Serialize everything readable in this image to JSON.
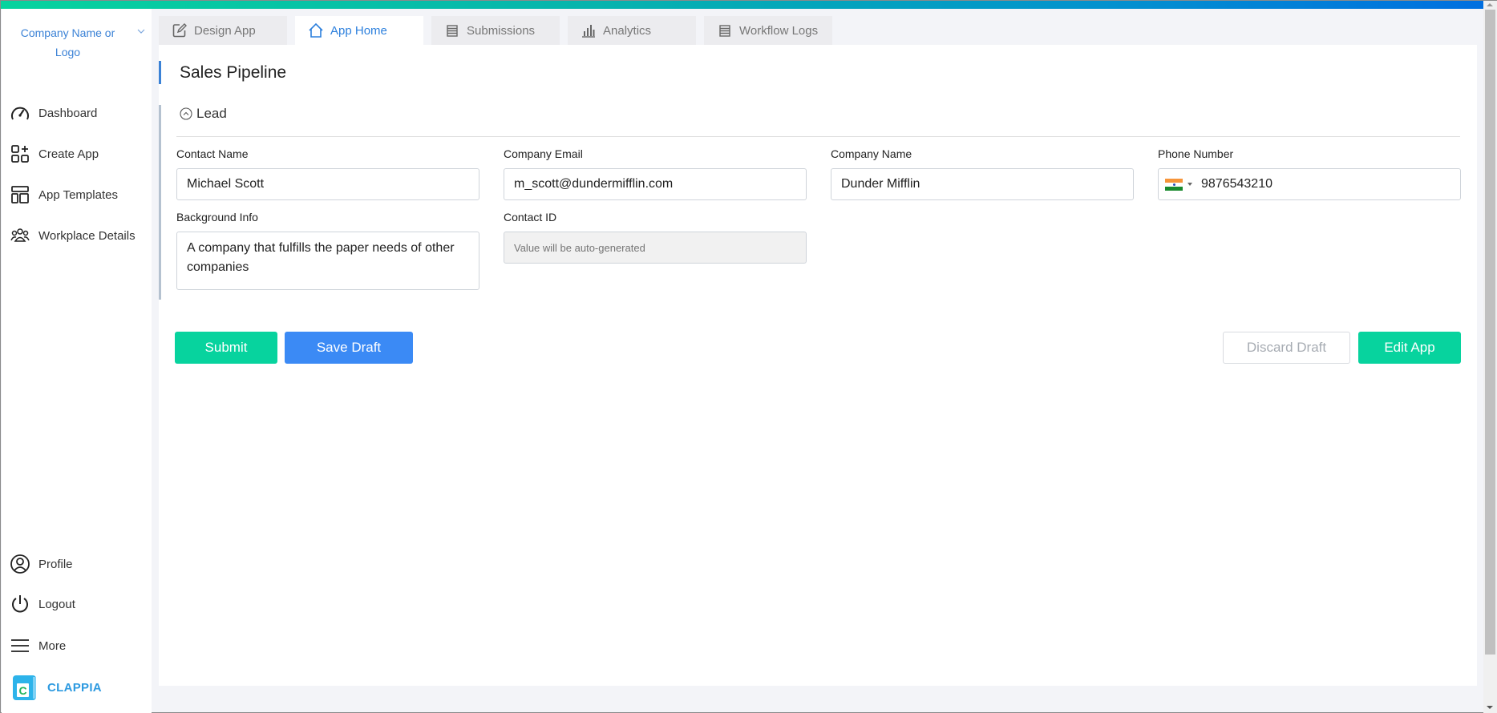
{
  "sidebar": {
    "company": "Company Name or Logo",
    "items": [
      {
        "label": "Dashboard",
        "icon": "speedometer-icon"
      },
      {
        "label": "Create App",
        "icon": "add-app-icon"
      },
      {
        "label": "App Templates",
        "icon": "templates-icon"
      },
      {
        "label": "Workplace Details",
        "icon": "users-icon"
      }
    ],
    "bottom_items": [
      {
        "label": "Profile",
        "icon": "user-circle-icon"
      },
      {
        "label": "Logout",
        "icon": "power-icon"
      },
      {
        "label": "More",
        "icon": "menu-icon"
      }
    ],
    "brand": "CLAPPIA"
  },
  "tabs": [
    {
      "label": "Design App",
      "icon": "edit-icon",
      "active": false
    },
    {
      "label": "App Home",
      "icon": "home-icon",
      "active": true
    },
    {
      "label": "Submissions",
      "icon": "list-icon",
      "active": false
    },
    {
      "label": "Analytics",
      "icon": "bar-chart-icon",
      "active": false
    },
    {
      "label": "Workflow Logs",
      "icon": "list-icon",
      "active": false
    }
  ],
  "page": {
    "title": "Sales Pipeline",
    "section": "Lead"
  },
  "form": {
    "contact_name": {
      "label": "Contact Name",
      "value": "Michael Scott"
    },
    "company_email": {
      "label": "Company Email",
      "value": "m_scott@dundermifflin.com"
    },
    "company_name": {
      "label": "Company Name",
      "value": "Dunder Mifflin"
    },
    "phone_number": {
      "label": "Phone Number",
      "value": "9876543210",
      "country": "India"
    },
    "background_info": {
      "label": "Background Info",
      "value": "A company that fulfills the paper needs of other companies"
    },
    "contact_id": {
      "label": "Contact ID",
      "placeholder": "Value will be auto-generated"
    }
  },
  "actions": {
    "submit": "Submit",
    "save_draft": "Save Draft",
    "discard_draft": "Discard Draft",
    "edit_app": "Edit App"
  },
  "colors": {
    "primary_green": "#07d39e",
    "primary_blue": "#3b8af5",
    "link_blue": "#3b82d6"
  }
}
